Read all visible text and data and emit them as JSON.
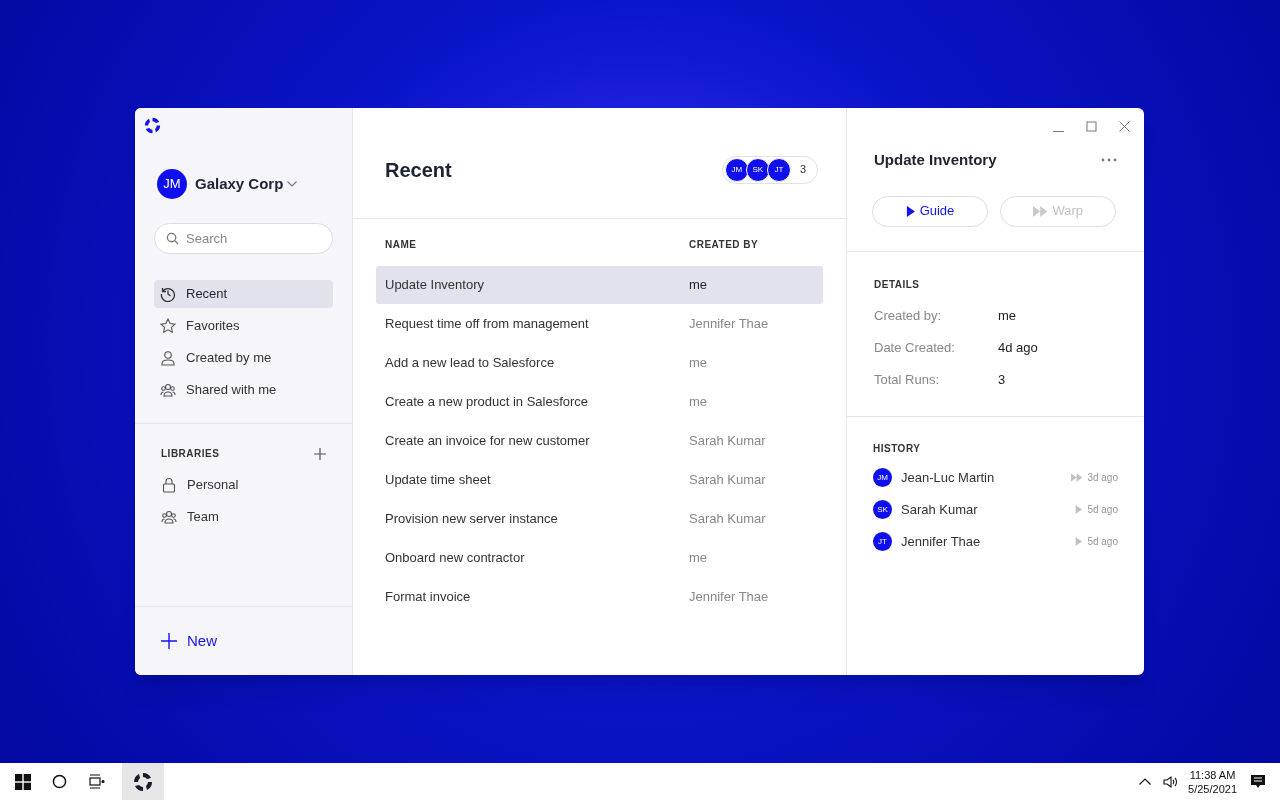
{
  "org": {
    "avatar": "JM",
    "name": "Galaxy Corp"
  },
  "search": {
    "placeholder": "Search"
  },
  "nav": [
    {
      "label": "Recent",
      "kind": "clock",
      "selected": true
    },
    {
      "label": "Favorites",
      "kind": "star",
      "selected": false
    },
    {
      "label": "Created by me",
      "kind": "user",
      "selected": false
    },
    {
      "label": "Shared with me",
      "kind": "users",
      "selected": false
    }
  ],
  "libraries": {
    "title": "LIBRARIES",
    "items": [
      {
        "label": "Personal",
        "kind": "lock"
      },
      {
        "label": "Team",
        "kind": "users"
      }
    ]
  },
  "new_button": "New",
  "main": {
    "title": "Recent",
    "collaborators": [
      "JM",
      "SK",
      "JT"
    ],
    "collaborator_count": "3",
    "columns": [
      "NAME",
      "CREATED BY"
    ],
    "rows": [
      {
        "name": "Update Inventory",
        "created_by": "me",
        "selected": true
      },
      {
        "name": "Request time off from management",
        "created_by": "Jennifer Thae",
        "selected": false
      },
      {
        "name": "Add a new lead to Salesforce",
        "created_by": "me",
        "selected": false
      },
      {
        "name": "Create a new product in Salesforce",
        "created_by": "me",
        "selected": false
      },
      {
        "name": "Create an invoice for new customer",
        "created_by": "Sarah Kumar",
        "selected": false
      },
      {
        "name": "Update time sheet",
        "created_by": "Sarah Kumar",
        "selected": false
      },
      {
        "name": "Provision new server instance",
        "created_by": "Sarah Kumar",
        "selected": false
      },
      {
        "name": "Onboard new contractor",
        "created_by": "me",
        "selected": false
      },
      {
        "name": "Format invoice",
        "created_by": "Jennifer Thae",
        "selected": false
      }
    ]
  },
  "detail": {
    "title": "Update Inventory",
    "actions": [
      {
        "label": "Guide",
        "kind": "guide",
        "disabled": false
      },
      {
        "label": "Warp",
        "kind": "warp",
        "disabled": true
      }
    ],
    "details": {
      "title": "DETAILS",
      "fields": [
        {
          "label": "Created by:",
          "value": "me"
        },
        {
          "label": "Date Created:",
          "value": "4d ago"
        },
        {
          "label": "Total Runs:",
          "value": "3"
        }
      ]
    },
    "history": {
      "title": "HISTORY",
      "items": [
        {
          "initials": "JM",
          "name": "Jean-Luc Martin",
          "kind": "warp",
          "time": "3d ago"
        },
        {
          "initials": "SK",
          "name": "Sarah Kumar",
          "kind": "guide",
          "time": "5d ago"
        },
        {
          "initials": "JT",
          "name": "Jennifer Thae",
          "kind": "guide",
          "time": "5d ago"
        }
      ]
    }
  },
  "taskbar": {
    "time": "11:38 AM",
    "date": "5/25/2021"
  }
}
